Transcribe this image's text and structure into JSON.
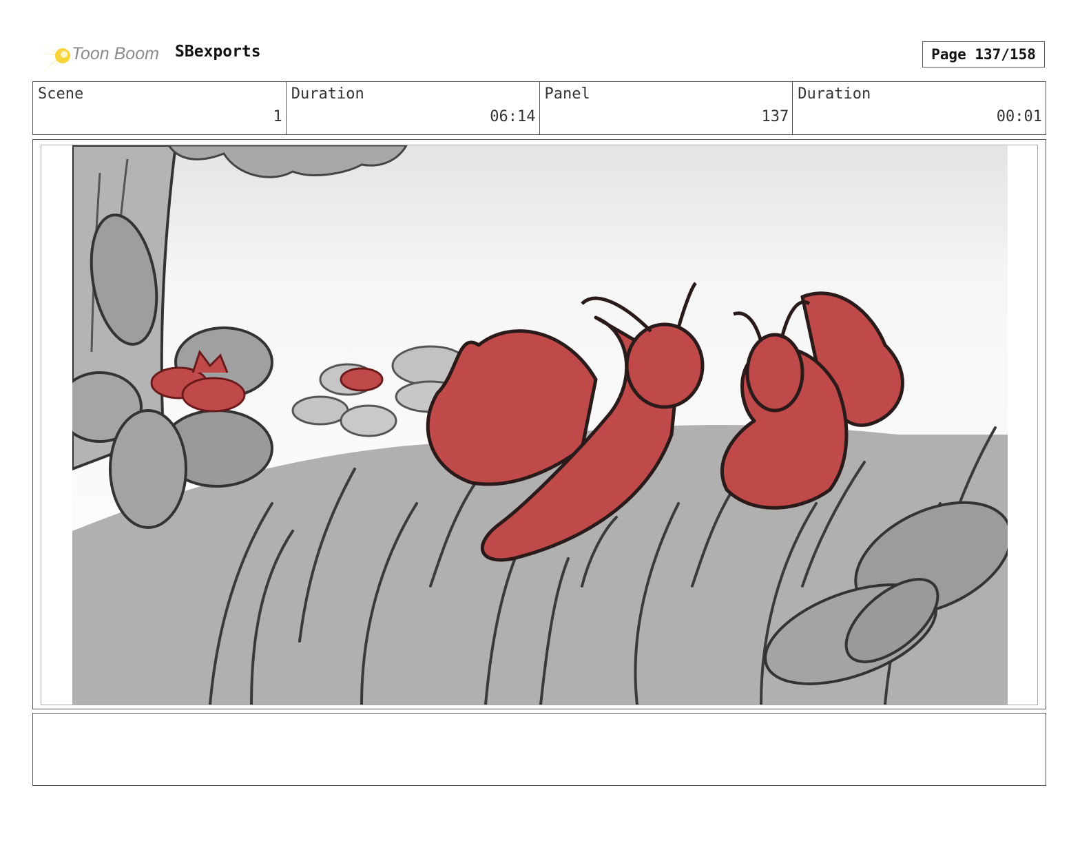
{
  "header": {
    "logo_text": "Toon Boom",
    "project_title": "SBexports",
    "page_label": "Page 137/158"
  },
  "info": {
    "scene_label": "Scene",
    "scene_value": "1",
    "scene_duration_label": "Duration",
    "scene_duration_value": "06:14",
    "panel_label": "Panel",
    "panel_value": "137",
    "panel_duration_label": "Duration",
    "panel_duration_value": "00:01"
  },
  "notes": {
    "text": ""
  },
  "colors": {
    "logo_yellow": "#f6c21c",
    "character_red": "#c04a4a",
    "outline_dark": "#2a2a2a",
    "grass_gray": "#a8a8a8"
  }
}
